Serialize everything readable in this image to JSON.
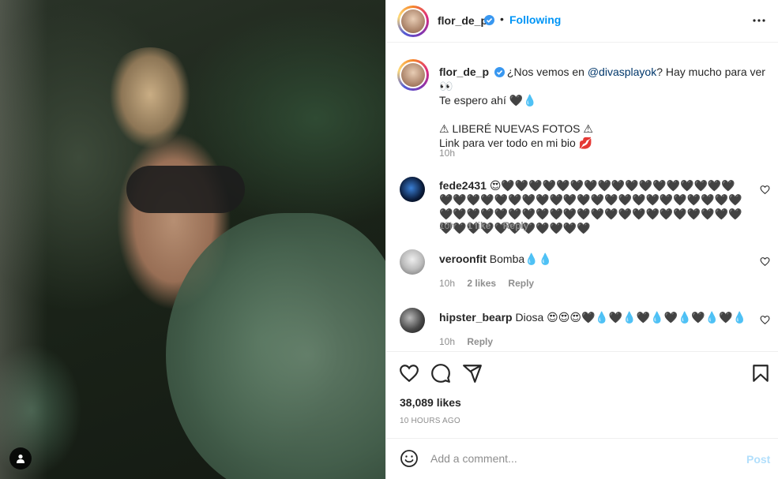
{
  "post": {
    "author": "flor_de_p",
    "follow_status": "Following",
    "separator": "•",
    "caption": {
      "text_before": "¿Nos vemos en ",
      "mention": "@divasplayok",
      "text_after": "? Hay mucho para ver 👀",
      "line2": "Te espero ahí 🖤💧",
      "line3": "⚠ LIBERÉ NUEVAS FOTOS ⚠",
      "line4": "Link para ver todo en mi bio 💋"
    },
    "caption_time": "10h",
    "likes": "38,089 likes",
    "posted": "10 HOURS AGO"
  },
  "comments": [
    {
      "username": "fede2431",
      "text": "😍🖤🖤🖤🖤🖤🖤🖤🖤🖤🖤🖤🖤🖤🖤🖤🖤🖤🖤🖤🖤🖤🖤🖤🖤🖤🖤🖤🖤🖤🖤🖤🖤🖤🖤🖤🖤🖤🖤🖤🖤🖤🖤🖤🖤🖤🖤🖤🖤🖤🖤🖤🖤🖤🖤🖤🖤🖤🖤🖤🖤🖤🖤🖤🖤🖤🖤🖤🖤🖤🖤🖤🖤",
      "time": "10h",
      "likes": "1 like",
      "reply": "Reply"
    },
    {
      "username": "veroonfit",
      "text": "Bomba💧💧",
      "time": "10h",
      "likes": "2 likes",
      "reply": "Reply"
    },
    {
      "username": "hipster_bearp",
      "text": "Diosa 😍😍😍🖤💧🖤💧🖤💧🖤💧🖤💧🖤💧",
      "time": "10h",
      "likes": "",
      "reply": "Reply"
    }
  ],
  "comment_box": {
    "placeholder": "Add a comment...",
    "post_label": "Post"
  },
  "icons": {
    "more": "more-horizontal-icon",
    "like": "heart-icon",
    "comment": "comment-bubble-icon",
    "share": "paper-plane-icon",
    "save": "bookmark-icon",
    "emoji": "smiley-icon",
    "tag": "user-tag-icon",
    "verified": "verified-badge-icon"
  },
  "colors": {
    "accent": "#0095f6",
    "verified": "#3897f0",
    "text": "#262626",
    "secondary": "#8e8e8e",
    "post_disabled": "#b2dffc"
  }
}
